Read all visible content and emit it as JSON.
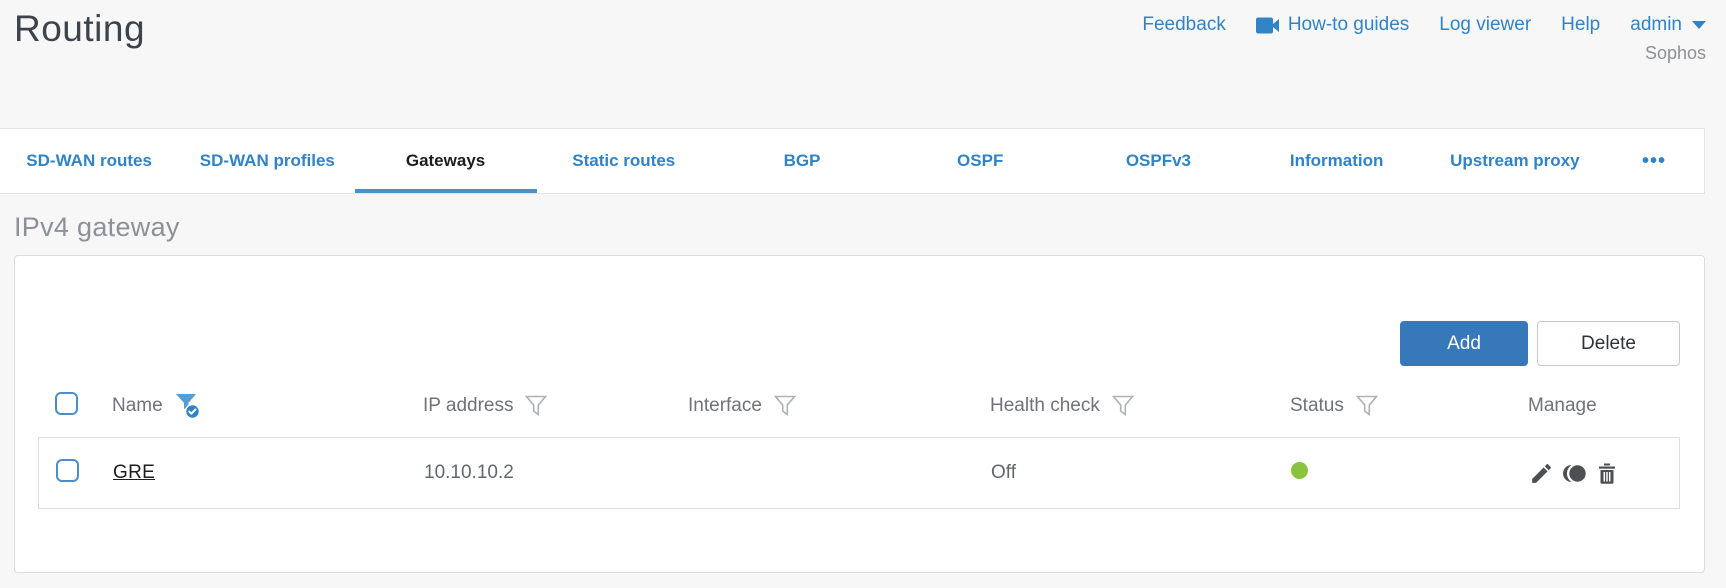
{
  "page": {
    "title": "Routing"
  },
  "header": {
    "feedback": "Feedback",
    "howto_guides": "How-to guides",
    "log_viewer": "Log viewer",
    "help": "Help",
    "user": "admin",
    "brand": "Sophos"
  },
  "tabs": {
    "items": [
      {
        "label": "SD-WAN routes",
        "active": false
      },
      {
        "label": "SD-WAN profiles",
        "active": false
      },
      {
        "label": "Gateways",
        "active": true
      },
      {
        "label": "Static routes",
        "active": false
      },
      {
        "label": "BGP",
        "active": false
      },
      {
        "label": "OSPF",
        "active": false
      },
      {
        "label": "OSPFv3",
        "active": false
      },
      {
        "label": "Information",
        "active": false
      },
      {
        "label": "Upstream proxy",
        "active": false
      }
    ],
    "overflow_label": "•••"
  },
  "section": {
    "heading": "IPv4 gateway"
  },
  "toolbar": {
    "add_label": "Add",
    "delete_label": "Delete"
  },
  "table": {
    "columns": [
      {
        "label": "Name",
        "filter": "active"
      },
      {
        "label": "IP address",
        "filter": "default"
      },
      {
        "label": "Interface",
        "filter": "default"
      },
      {
        "label": "Health check",
        "filter": "default"
      },
      {
        "label": "Status",
        "filter": "default"
      },
      {
        "label": "Manage",
        "filter": "none"
      }
    ],
    "rows": [
      {
        "name": "GRE",
        "ip_address": "10.10.10.2",
        "interface": "",
        "health_check": "Off",
        "status": "up",
        "manage_icons": [
          "edit-icon",
          "clone-icon",
          "delete-icon"
        ]
      }
    ]
  },
  "colors": {
    "accent_blue": "#3083c6",
    "button_blue": "#3678ba",
    "status_green": "#8ac43f",
    "active_tab_underline": "#4b90c8"
  }
}
